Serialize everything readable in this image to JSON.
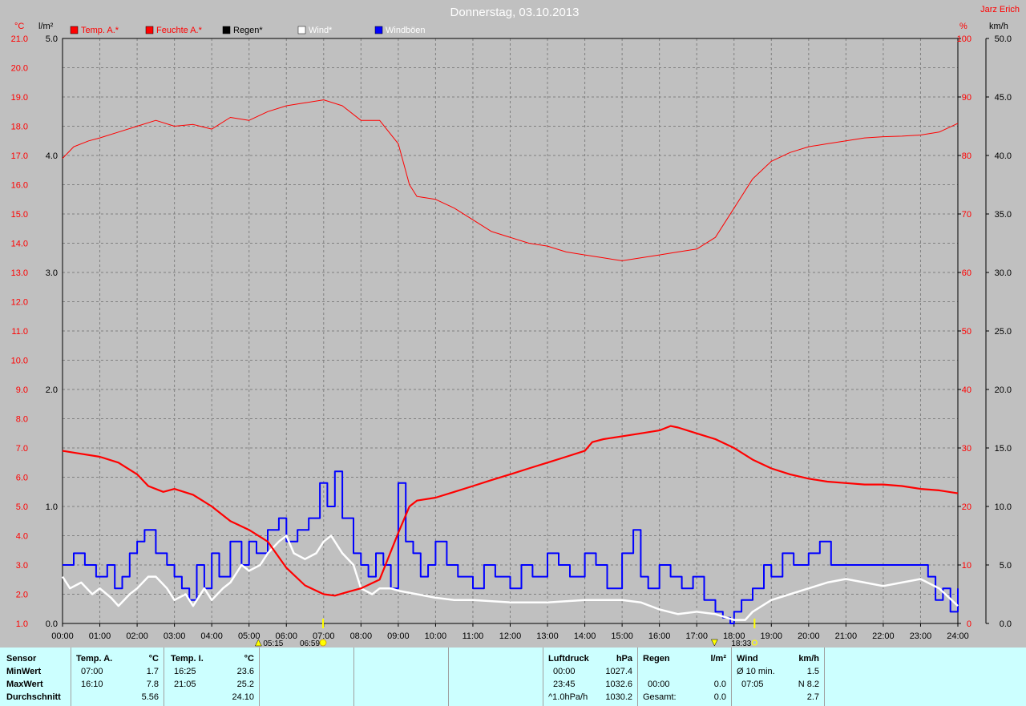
{
  "title": "Donnerstag, 03.10.2013",
  "author": "Jarz Erich",
  "axes": {
    "left1_unit": "°C",
    "left2_unit": "l/m²",
    "right1_unit": "%",
    "right2_unit": "km/h",
    "temp_ticks": [
      "21.0",
      "20.0",
      "19.0",
      "18.0",
      "17.0",
      "16.0",
      "15.0",
      "14.0",
      "13.0",
      "12.0",
      "11.0",
      "10.0",
      "9.0",
      "8.0",
      "7.0",
      "6.0",
      "5.0",
      "4.0",
      "3.0",
      "2.0",
      "1.0"
    ],
    "rain_ticks": [
      "5.0",
      "4.0",
      "3.0",
      "2.0",
      "1.0",
      "0.0"
    ],
    "hum_ticks": [
      "100",
      "90",
      "80",
      "70",
      "60",
      "50",
      "40",
      "30",
      "20",
      "10",
      "0"
    ],
    "wind_ticks": [
      "50.0",
      "45.0",
      "40.0",
      "35.0",
      "30.0",
      "25.0",
      "20.0",
      "15.0",
      "10.0",
      "5.0",
      "0.0"
    ],
    "time_ticks": [
      "00:00",
      "01:00",
      "02:00",
      "03:00",
      "04:00",
      "05:00",
      "06:00",
      "07:00",
      "08:00",
      "09:00",
      "10:00",
      "11:00",
      "12:00",
      "13:00",
      "14:00",
      "15:00",
      "16:00",
      "17:00",
      "18:00",
      "19:00",
      "20:00",
      "21:00",
      "22:00",
      "23:00",
      "24:00"
    ]
  },
  "legend": [
    {
      "label": "Temp. A.*",
      "color": "#ff0000",
      "text_color": "#ff0000"
    },
    {
      "label": "Feuchte A.*",
      "color": "#ff0000",
      "text_color": "#ff0000"
    },
    {
      "label": "Regen*",
      "color": "#000000",
      "text_color": "#000000"
    },
    {
      "label": "Wind*",
      "color": "#ffffff",
      "text_color": "#ffffff"
    },
    {
      "label": "Windböen",
      "color": "#0000ff",
      "text_color": "#ffffff"
    }
  ],
  "sun": {
    "dawn": "05:15",
    "sunrise": "06:59",
    "sunset": "18:33"
  },
  "chart_data": {
    "type": "line",
    "x_unit": "hour",
    "xlim": [
      0,
      24
    ],
    "temp_ylim": [
      1,
      21
    ],
    "rain_ylim": [
      0,
      5
    ],
    "hum_ylim": [
      0,
      100
    ],
    "wind_ylim": [
      0,
      50
    ],
    "grid": true,
    "series": [
      {
        "name": "Temp. A.*",
        "axis": "temp",
        "color": "#ff0000",
        "x": [
          0,
          0.5,
          1,
          1.5,
          2,
          2.3,
          2.7,
          3,
          3.5,
          4,
          4.5,
          5,
          5.5,
          6,
          6.5,
          7,
          7.3,
          7.7,
          8,
          8.5,
          9,
          9.3,
          9.5,
          10,
          10.5,
          11,
          11.5,
          12,
          12.5,
          13,
          13.5,
          14,
          14.2,
          14.5,
          15,
          15.5,
          16,
          16.3,
          16.5,
          17,
          17.5,
          18,
          18.5,
          19,
          19.5,
          20,
          20.5,
          21,
          21.5,
          22,
          22.5,
          23,
          23.5,
          24
        ],
        "y": [
          6.9,
          6.8,
          6.7,
          6.5,
          6.1,
          5.7,
          5.5,
          5.6,
          5.4,
          5.0,
          4.5,
          4.2,
          3.8,
          2.9,
          2.3,
          2.0,
          1.95,
          2.1,
          2.2,
          2.5,
          4.1,
          5.0,
          5.2,
          5.3,
          5.5,
          5.7,
          5.9,
          6.1,
          6.3,
          6.5,
          6.7,
          6.9,
          7.2,
          7.3,
          7.4,
          7.5,
          7.6,
          7.75,
          7.7,
          7.5,
          7.3,
          7.0,
          6.6,
          6.3,
          6.1,
          5.95,
          5.85,
          5.8,
          5.75,
          5.75,
          5.7,
          5.6,
          5.55,
          5.45
        ]
      },
      {
        "name": "Feuchte A.*",
        "axis": "hum",
        "color": "#ff0000",
        "x": [
          0,
          0.3,
          0.7,
          1,
          1.5,
          2,
          2.5,
          3,
          3.5,
          4,
          4.5,
          5,
          5.5,
          6,
          6.5,
          7,
          7.5,
          8,
          8.5,
          9,
          9.3,
          9.5,
          10,
          10.5,
          11,
          11.5,
          12,
          12.5,
          13,
          13.5,
          14,
          14.5,
          15,
          15.5,
          16,
          16.5,
          17,
          17.5,
          18,
          18.5,
          19,
          19.5,
          20,
          20.5,
          21,
          21.5,
          22,
          22.5,
          23,
          23.5,
          24
        ],
        "y": [
          79.5,
          81.5,
          82.5,
          83,
          84,
          85,
          86,
          85,
          85.3,
          84.5,
          86.5,
          86,
          87.5,
          88.5,
          89,
          89.5,
          88.5,
          86,
          86,
          82,
          75,
          73,
          72.5,
          71,
          69,
          67,
          66,
          65,
          64.5,
          63.5,
          63,
          62.5,
          62,
          62.5,
          63,
          63.5,
          64,
          66,
          71,
          76,
          79,
          80.5,
          81.5,
          82,
          82.5,
          83,
          83.2,
          83.3,
          83.5,
          84,
          85.5
        ]
      },
      {
        "name": "Wind*",
        "axis": "wind",
        "color": "#ffffff",
        "x": [
          0,
          0.2,
          0.5,
          0.8,
          1,
          1.3,
          1.5,
          1.8,
          2,
          2.3,
          2.5,
          2.8,
          3,
          3.3,
          3.5,
          3.8,
          4,
          4.3,
          4.5,
          4.8,
          5,
          5.3,
          5.5,
          5.8,
          6,
          6.2,
          6.5,
          6.8,
          7,
          7.2,
          7.5,
          7.8,
          8,
          8.3,
          8.5,
          8.8,
          9,
          9.5,
          10,
          10.5,
          11,
          12,
          13,
          14,
          14.5,
          15,
          15.5,
          16,
          16.5,
          17,
          17.5,
          17.8,
          18,
          18.3,
          18.5,
          19,
          19.5,
          20,
          20.5,
          21,
          21.5,
          22,
          22.5,
          23,
          23.5,
          24
        ],
        "y": [
          4,
          3,
          3.5,
          2.5,
          3,
          2.2,
          1.5,
          2.5,
          3,
          4,
          4,
          3,
          2,
          2.5,
          1.5,
          3,
          2,
          3,
          3.5,
          5,
          4.5,
          5,
          6,
          7,
          7.5,
          6,
          5.5,
          6,
          7,
          7.5,
          6,
          5,
          3,
          2.5,
          3,
          3,
          2.8,
          2.5,
          2.2,
          2,
          2,
          1.8,
          1.8,
          2,
          2,
          2,
          1.8,
          1.2,
          0.8,
          1,
          0.8,
          0.5,
          0.3,
          0.3,
          1,
          2,
          2.5,
          3,
          3.5,
          3.8,
          3.5,
          3.2,
          3.5,
          3.8,
          3,
          1.5
        ]
      },
      {
        "name": "Windböen",
        "axis": "wind",
        "color": "#0000ff",
        "x": [
          0,
          0.3,
          0.6,
          0.9,
          1.2,
          1.4,
          1.6,
          1.8,
          2,
          2.2,
          2.5,
          2.8,
          3,
          3.2,
          3.4,
          3.6,
          3.8,
          4,
          4.2,
          4.5,
          4.8,
          5,
          5.2,
          5.5,
          5.8,
          6,
          6.3,
          6.6,
          6.9,
          7.1,
          7.3,
          7.5,
          7.8,
          8,
          8.2,
          8.4,
          8.6,
          8.8,
          9,
          9.2,
          9.4,
          9.6,
          9.8,
          10,
          10.3,
          10.6,
          11,
          11.3,
          11.6,
          12,
          12.3,
          12.6,
          13,
          13.3,
          13.6,
          14,
          14.3,
          14.6,
          15,
          15.3,
          15.5,
          15.7,
          16,
          16.3,
          16.6,
          16.9,
          17.2,
          17.5,
          17.7,
          17.9,
          18,
          18.2,
          18.5,
          18.8,
          19,
          19.3,
          19.6,
          20,
          20.3,
          20.6,
          21,
          21.5,
          22,
          22.5,
          23,
          23.2,
          23.4,
          23.6,
          23.8,
          24
        ],
        "y": [
          5,
          6,
          5,
          4,
          5,
          3,
          4,
          6,
          7,
          8,
          6,
          5,
          4,
          3,
          2,
          5,
          3,
          6,
          4,
          7,
          5,
          7,
          6,
          8,
          9,
          7,
          8,
          9,
          12,
          10,
          13,
          9,
          6,
          5,
          4,
          6,
          5,
          3,
          12,
          7,
          6,
          4,
          5,
          7,
          5,
          4,
          3,
          5,
          4,
          3,
          5,
          4,
          6,
          5,
          4,
          6,
          5,
          3,
          6,
          8,
          4,
          3,
          5,
          4,
          3,
          4,
          2,
          1,
          0.5,
          0,
          1,
          2,
          3,
          5,
          4,
          6,
          5,
          6,
          7,
          5,
          5,
          5,
          5,
          5,
          5,
          4,
          2,
          3,
          1,
          3
        ]
      }
    ]
  },
  "table": {
    "sensor": {
      "h": "Sensor",
      "rows": [
        "MinWert",
        "MaxWert",
        "Durchschnitt"
      ]
    },
    "temp_a": {
      "h": "Temp. A.",
      "unit": "°C",
      "times": [
        "07:00",
        "16:10",
        ""
      ],
      "values": [
        "1.7",
        "7.8",
        "5.56"
      ]
    },
    "temp_i": {
      "h": "Temp. I.",
      "unit": "°C",
      "times": [
        "16:25",
        "21:05",
        ""
      ],
      "values": [
        "23.6",
        "25.2",
        "24.10"
      ]
    },
    "luft": {
      "h": "Luftdruck",
      "unit": "hPa",
      "times": [
        "00:00",
        "23:45",
        "^1.0hPa/h"
      ],
      "values": [
        "1027.4",
        "1032.6",
        "1030.2"
      ]
    },
    "regen": {
      "h": "Regen",
      "unit": "l/m²",
      "times": [
        "",
        "00:00",
        "Gesamt:"
      ],
      "values": [
        "",
        "0.0",
        "0.0"
      ]
    },
    "wind": {
      "h": "Wind",
      "unit": "km/h",
      "times": [
        "Ø 10 min.",
        "07:05",
        ""
      ],
      "values": [
        "1.5",
        "N 8.2",
        "2.7"
      ]
    }
  }
}
